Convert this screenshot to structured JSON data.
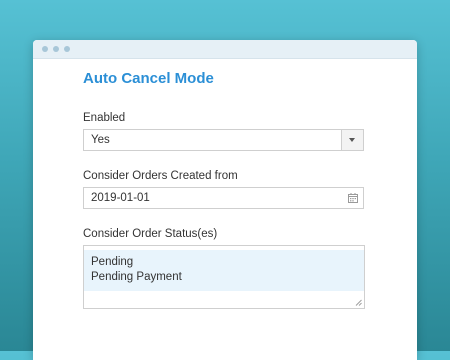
{
  "form": {
    "title": "Auto Cancel Mode",
    "enabled": {
      "label": "Enabled",
      "selected": "Yes"
    },
    "created_from": {
      "label": "Consider Orders Created from",
      "value": "2019-01-01"
    },
    "order_status": {
      "label": "Consider Order Status(es)",
      "options": [
        "Pending",
        "Pending Payment"
      ]
    }
  },
  "icons": {
    "select_arrow": "chevron-down-icon",
    "date_picker": "calendar-icon",
    "textarea_resize": "resize-handle-icon"
  },
  "colors": {
    "title": "#2b8fd6",
    "selected_option_bg": "#e8f4fc",
    "background_top": "#56c1d4",
    "background_bottom": "#2a8795"
  }
}
